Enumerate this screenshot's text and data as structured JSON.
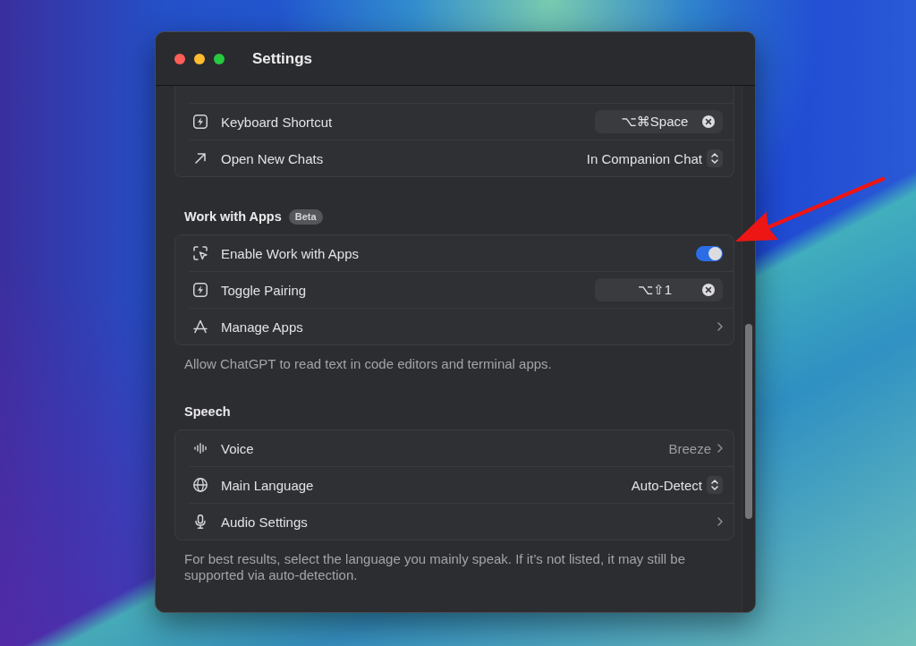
{
  "window": {
    "title": "Settings"
  },
  "sections": [
    {
      "rows": [
        {
          "kind": "shortcut",
          "label": "Keyboard Shortcut",
          "value": "⌥⌘Space"
        },
        {
          "kind": "popup",
          "label": "Open New Chats",
          "value": "In Companion Chat"
        }
      ]
    },
    {
      "heading": "Work with Apps",
      "badge": "Beta",
      "rows": [
        {
          "kind": "toggle",
          "label": "Enable Work with Apps",
          "on": true
        },
        {
          "kind": "shortcut",
          "label": "Toggle Pairing",
          "value": "⌥⇧1"
        },
        {
          "kind": "disclosure",
          "label": "Manage Apps"
        }
      ],
      "caption": "Allow ChatGPT to read text in code editors and terminal apps."
    },
    {
      "heading": "Speech",
      "rows": [
        {
          "kind": "disclosure",
          "label": "Voice",
          "value": "Breeze"
        },
        {
          "kind": "popup",
          "label": "Main Language",
          "value": "Auto-Detect"
        },
        {
          "kind": "disclosure",
          "label": "Audio Settings"
        }
      ],
      "caption": "For best results, select the language you mainly speak. If it’s not listed, it may still be supported via auto-detection."
    }
  ]
}
